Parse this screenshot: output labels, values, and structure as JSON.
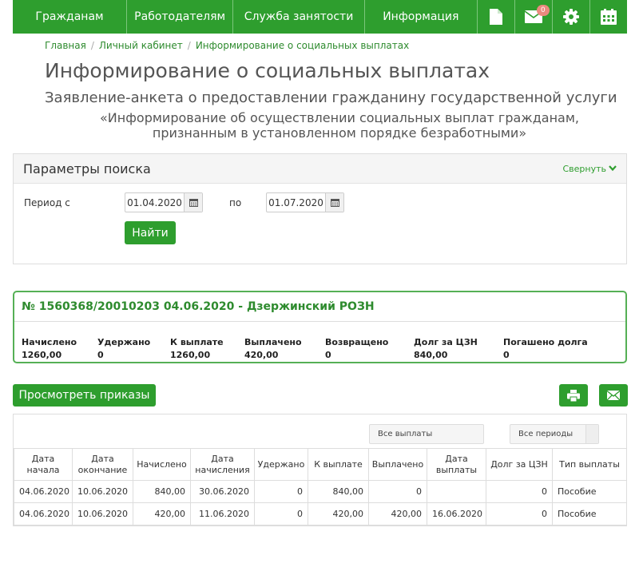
{
  "nav": {
    "items": [
      "Гражданам",
      "Работодателям",
      "Служба занятости",
      "Информация"
    ],
    "icons": [
      "document-icon",
      "mail-icon",
      "gear-icon",
      "calendar-icon"
    ],
    "mail_badge": "0"
  },
  "breadcrumb": [
    "Главная",
    "Личный кабинет",
    "Информирование о социальных выплатах"
  ],
  "page": {
    "title": "Информирование о социальных выплатах",
    "subtitle": "Заявление-анкета о предоставлении гражданину государственной услуги",
    "subtitle2": "«Информирование об осуществлении социальных выплат гражданам, признанным в установленном порядке безработными»"
  },
  "search": {
    "title": "Параметры поиска",
    "collapse_label": "Свернуть",
    "period_from_label": "Период с",
    "date_from": "01.04.2020",
    "to_label": "по",
    "date_to": "01.07.2020",
    "find_label": "Найти"
  },
  "record": {
    "header": "№ 1560368/20010203 04.06.2020 - Дзержинский РОЗН",
    "fields": [
      {
        "label": "Начислено",
        "value": "1260,00"
      },
      {
        "label": "Удержано",
        "value": "0"
      },
      {
        "label": "К выплате",
        "value": "1260,00"
      },
      {
        "label": "Выплачено",
        "value": "420,00"
      },
      {
        "label": "Возвращено",
        "value": "0"
      },
      {
        "label": "Долг за ЦЗН",
        "value": "840,00"
      },
      {
        "label": "Погашено долга",
        "value": "0"
      }
    ]
  },
  "actions": {
    "view_orders_label": "Просмотреть приказы"
  },
  "table": {
    "filter_payments": "Все выплаты",
    "filter_periods": "Все периоды",
    "columns": [
      "Дата начала",
      "Дата окончание",
      "Начислено",
      "Дата начисления",
      "Удержано",
      "К выплате",
      "Выплачено",
      "Дата выплаты",
      "Долг за ЦЗН",
      "Тип выплаты"
    ],
    "rows": [
      [
        "04.06.2020",
        "10.06.2020",
        "840,00",
        "30.06.2020",
        "0",
        "840,00",
        "0",
        "",
        "0",
        "Пособие"
      ],
      [
        "04.06.2020",
        "10.06.2020",
        "420,00",
        "11.06.2020",
        "0",
        "420,00",
        "420,00",
        "16.06.2020",
        "0",
        "Пособие"
      ]
    ]
  },
  "colors": {
    "primary": "#2e9e2e",
    "badge": "#ea8a7e"
  }
}
